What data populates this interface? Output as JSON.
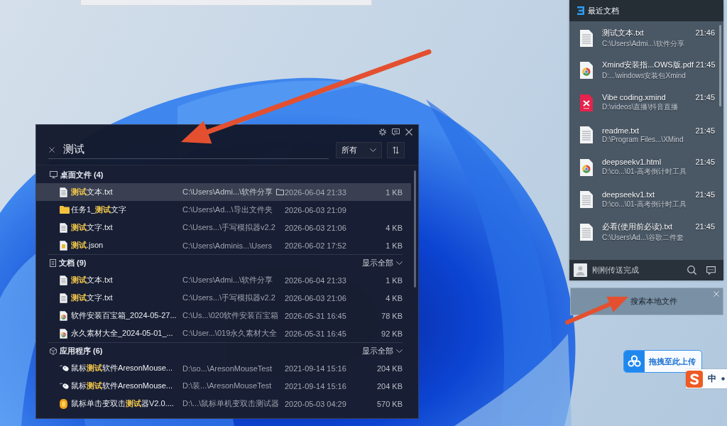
{
  "search_window": {
    "query": "测试",
    "filter": "所有",
    "sections": [
      {
        "kind": "desktop",
        "title": "桌面文件 (4)",
        "items": [
          {
            "kind": "text",
            "name": "**测试**文本.txt",
            "path": "C:\\Users\\Admi...\\软件分享",
            "modified": "2026-06-04 21:33",
            "size": "1 KB",
            "selected": true
          },
          {
            "kind": "folder",
            "name": "任务1_**测试**文字",
            "path": "C:\\Users\\Ad...\\导出文件夹",
            "modified": "2026-06-03 21:09",
            "selected": false
          },
          {
            "kind": "text",
            "name": "**测试**文字.txt",
            "path": "C:\\Users...\\手写模拟器v2.2",
            "modified": "2026-06-03 21:06",
            "size": "4 KB",
            "selected": false
          },
          {
            "kind": "json",
            "name": "**测试**.json",
            "path": "C:\\Users\\Adminis...\\Users",
            "modified": "2026-06-02 17:52",
            "size": "1 KB",
            "selected": false
          }
        ]
      },
      {
        "kind": "documents",
        "title": "文档 (9)",
        "show_all": "显示全部",
        "items": [
          {
            "kind": "text",
            "name": "**测试**文本.txt",
            "path": "C:\\Users\\Admi...\\软件分享",
            "modified": "2026-06-04 21:33",
            "size": "1 KB",
            "selected": false
          },
          {
            "kind": "text",
            "name": "**测试**文字.txt",
            "path": "C:\\Users...\\手写模拟器v2.2",
            "modified": "2026-06-03 21:06",
            "size": "4 KB",
            "selected": false
          },
          {
            "kind": "web",
            "name": "软件安装百宝箱_2024-05-27...",
            "path": "C:\\Us...\\020软件安装百宝箱",
            "modified": "2026-05-31 16:45",
            "size": "78 KB",
            "selected": false
          },
          {
            "kind": "web",
            "name": "永久素材大全_2024-05-01_...",
            "path": "C:\\User...\\019永久素材大全",
            "modified": "2026-05-31 16:45",
            "size": "92 KB",
            "selected": false
          }
        ]
      },
      {
        "kind": "apps",
        "title": "应用程序 (6)",
        "show_all": "显示全部",
        "items": [
          {
            "kind": "mouse",
            "name": "鼠标**测试**软件AresonMouse...",
            "path": "D:\\so...\\AresonMouseTest",
            "modified": "2021-09-14 15:16",
            "size": "204 KB",
            "selected": false
          },
          {
            "kind": "mouse",
            "name": "鼠标**测试**软件AresonMouse...",
            "path": "D:\\装...\\AresonMouseTest",
            "modified": "2021-09-14 15:16",
            "size": "204 KB",
            "selected": false
          },
          {
            "kind": "app",
            "name": "鼠标单击变双击**测试**器V2.0....",
            "path": "D:\\...\\鼠标单机变双击测试器",
            "modified": "2020-05-03 04:29",
            "size": "570 KB",
            "selected": false
          }
        ]
      }
    ]
  },
  "recent_panel": {
    "title": "最近文档",
    "items": [
      {
        "kind": "text",
        "name": "测试文本.txt",
        "time": "21:46",
        "path": "C:\\Users\\Admi...\\软件分享"
      },
      {
        "kind": "web",
        "name": "Xmind安装指...OWS版.pdf",
        "time": "21:45",
        "path": "D:...\\windows安装包Xmind"
      },
      {
        "kind": "xmind",
        "name": "Vibe coding.xmind",
        "time": "21:45",
        "path": "D:\\videos\\直播\\抖音直播"
      },
      {
        "kind": "text",
        "name": "readme.txt",
        "time": "21:45",
        "path": "D:\\Program Files...\\XMind"
      },
      {
        "kind": "web",
        "name": "deepseekv1.html",
        "time": "21:45",
        "path": "D:\\co...\\01-高考倒计时工具"
      },
      {
        "kind": "text",
        "name": "deepseekv1.txt",
        "time": "21:45",
        "path": "D:\\co...\\01-高考倒计时工具"
      },
      {
        "kind": "text",
        "name": "必看(使用前必读).txt",
        "time": "21:45",
        "path": "C:\\Users\\Ad...\\谷歌二件套"
      }
    ],
    "status": "刚刚传送完成"
  },
  "search_hint": {
    "label": "搜索本地文件"
  },
  "upload_badge": {
    "label": "拖拽至此上传"
  },
  "ime_bar": {
    "mode": "中"
  }
}
